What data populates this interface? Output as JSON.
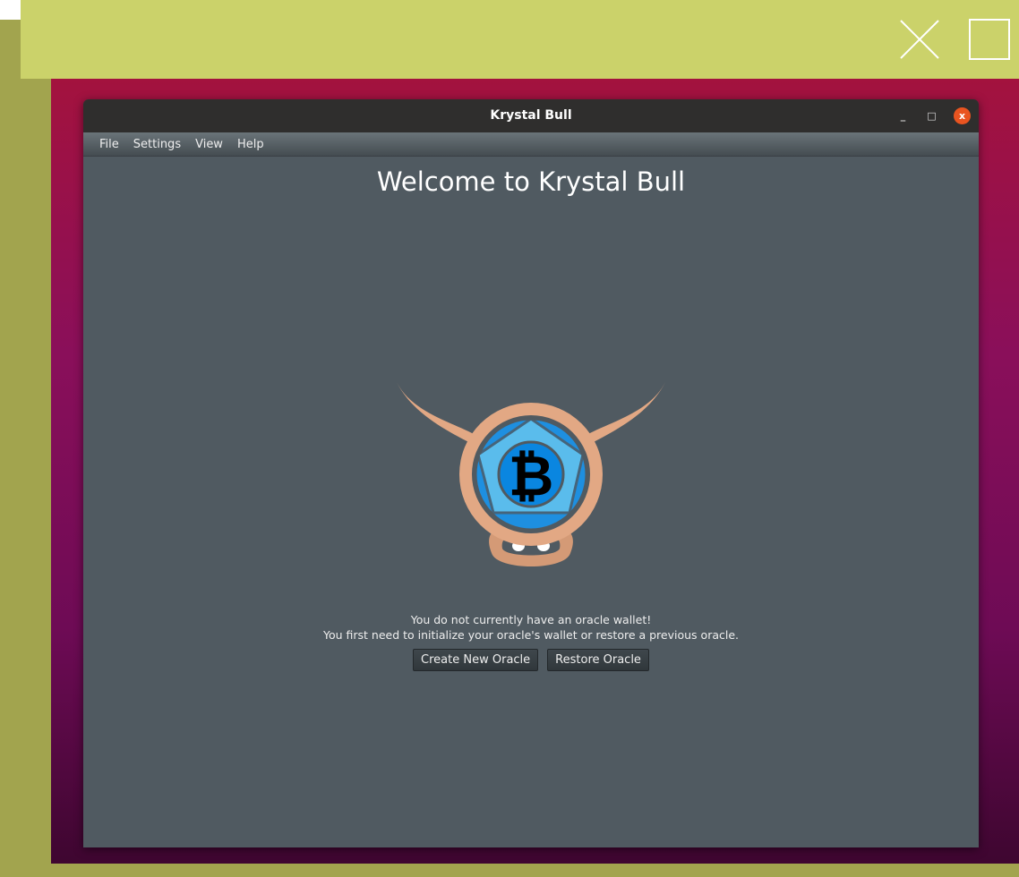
{
  "window": {
    "title": "Krystal Bull",
    "controls": {
      "minimize": "_",
      "maximize": "□",
      "close": "x"
    }
  },
  "menubar": {
    "items": [
      "File",
      "Settings",
      "View",
      "Help"
    ]
  },
  "main": {
    "heading": "Welcome to Krystal Bull",
    "message_line1": "You do not currently have an oracle wallet!",
    "message_line2": "You first need to initialize your oracle's wallet or restore a previous oracle.",
    "create_button": "Create New Oracle",
    "restore_button": "Restore Oracle"
  },
  "logo": {
    "name": "krystal-bull-logo",
    "symbol": "bitcoin"
  },
  "colors": {
    "accent_close": "#e95420",
    "content_bg": "#505a61",
    "topbar": "#cbd26a"
  }
}
